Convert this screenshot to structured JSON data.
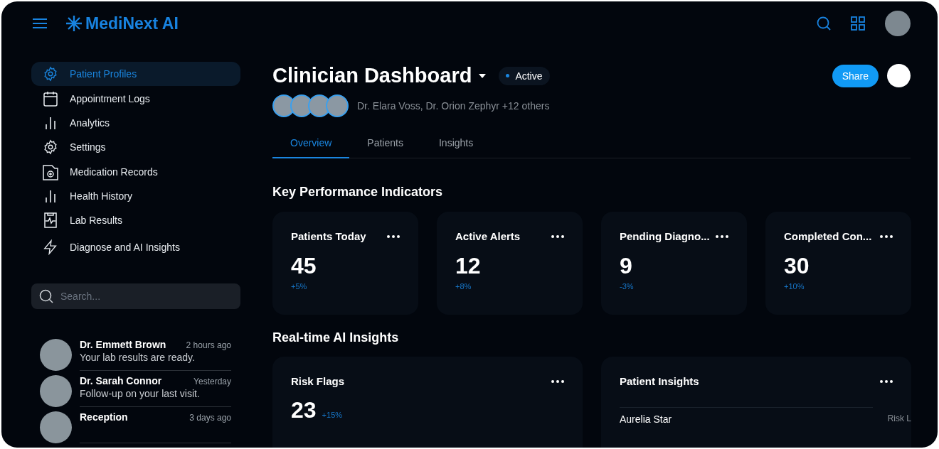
{
  "app": {
    "name": "MediNext AI"
  },
  "sidebar": {
    "items": [
      {
        "label": "Patient Profiles",
        "selected": true
      },
      {
        "label": "Appointment Logs",
        "selected": false
      },
      {
        "label": "Analytics",
        "selected": false
      },
      {
        "label": "Settings",
        "selected": false
      },
      {
        "label": "Medication Records",
        "selected": false
      },
      {
        "label": "Health History",
        "selected": false
      },
      {
        "label": "Lab Results",
        "selected": false
      },
      {
        "label": "Diagnose and AI Insights",
        "selected": false
      }
    ],
    "search": {
      "placeholder": "Search..."
    },
    "messages": [
      {
        "name": "Dr. Emmett Brown",
        "time": "2 hours ago",
        "text": "Your lab results are ready."
      },
      {
        "name": "Dr. Sarah Connor",
        "time": "Yesterday",
        "text": "Follow-up on your last visit."
      },
      {
        "name": "Reception",
        "time": "3 days ago"
      }
    ]
  },
  "page": {
    "title": "Clinician Dashboard",
    "status": "Active",
    "share": "Share",
    "collaborators": "Dr. Elara Voss, Dr. Orion Zephyr +12 others"
  },
  "tabs": [
    {
      "label": "Overview",
      "selected": true
    },
    {
      "label": "Patients",
      "selected": false
    },
    {
      "label": "Insights",
      "selected": false
    }
  ],
  "kpi": {
    "title": "Key Performance Indicators",
    "cards": [
      {
        "title": "Patients Today",
        "value": "45",
        "change": "+5%"
      },
      {
        "title": "Active Alerts",
        "value": "12",
        "change": "+8%"
      },
      {
        "title": "Pending Diagno...",
        "value": "9",
        "change": "-3%"
      },
      {
        "title": "Completed Con...",
        "value": "30",
        "change": "+10%"
      }
    ]
  },
  "insights": {
    "title": "Real-time AI Insights",
    "risk_flags": {
      "title": "Risk Flags",
      "value": "23",
      "change": "+15%"
    },
    "patient_insights": {
      "title": "Patient Insights",
      "column_2": "Risk L",
      "rows": [
        {
          "name": "Aurelia Star"
        }
      ]
    }
  }
}
